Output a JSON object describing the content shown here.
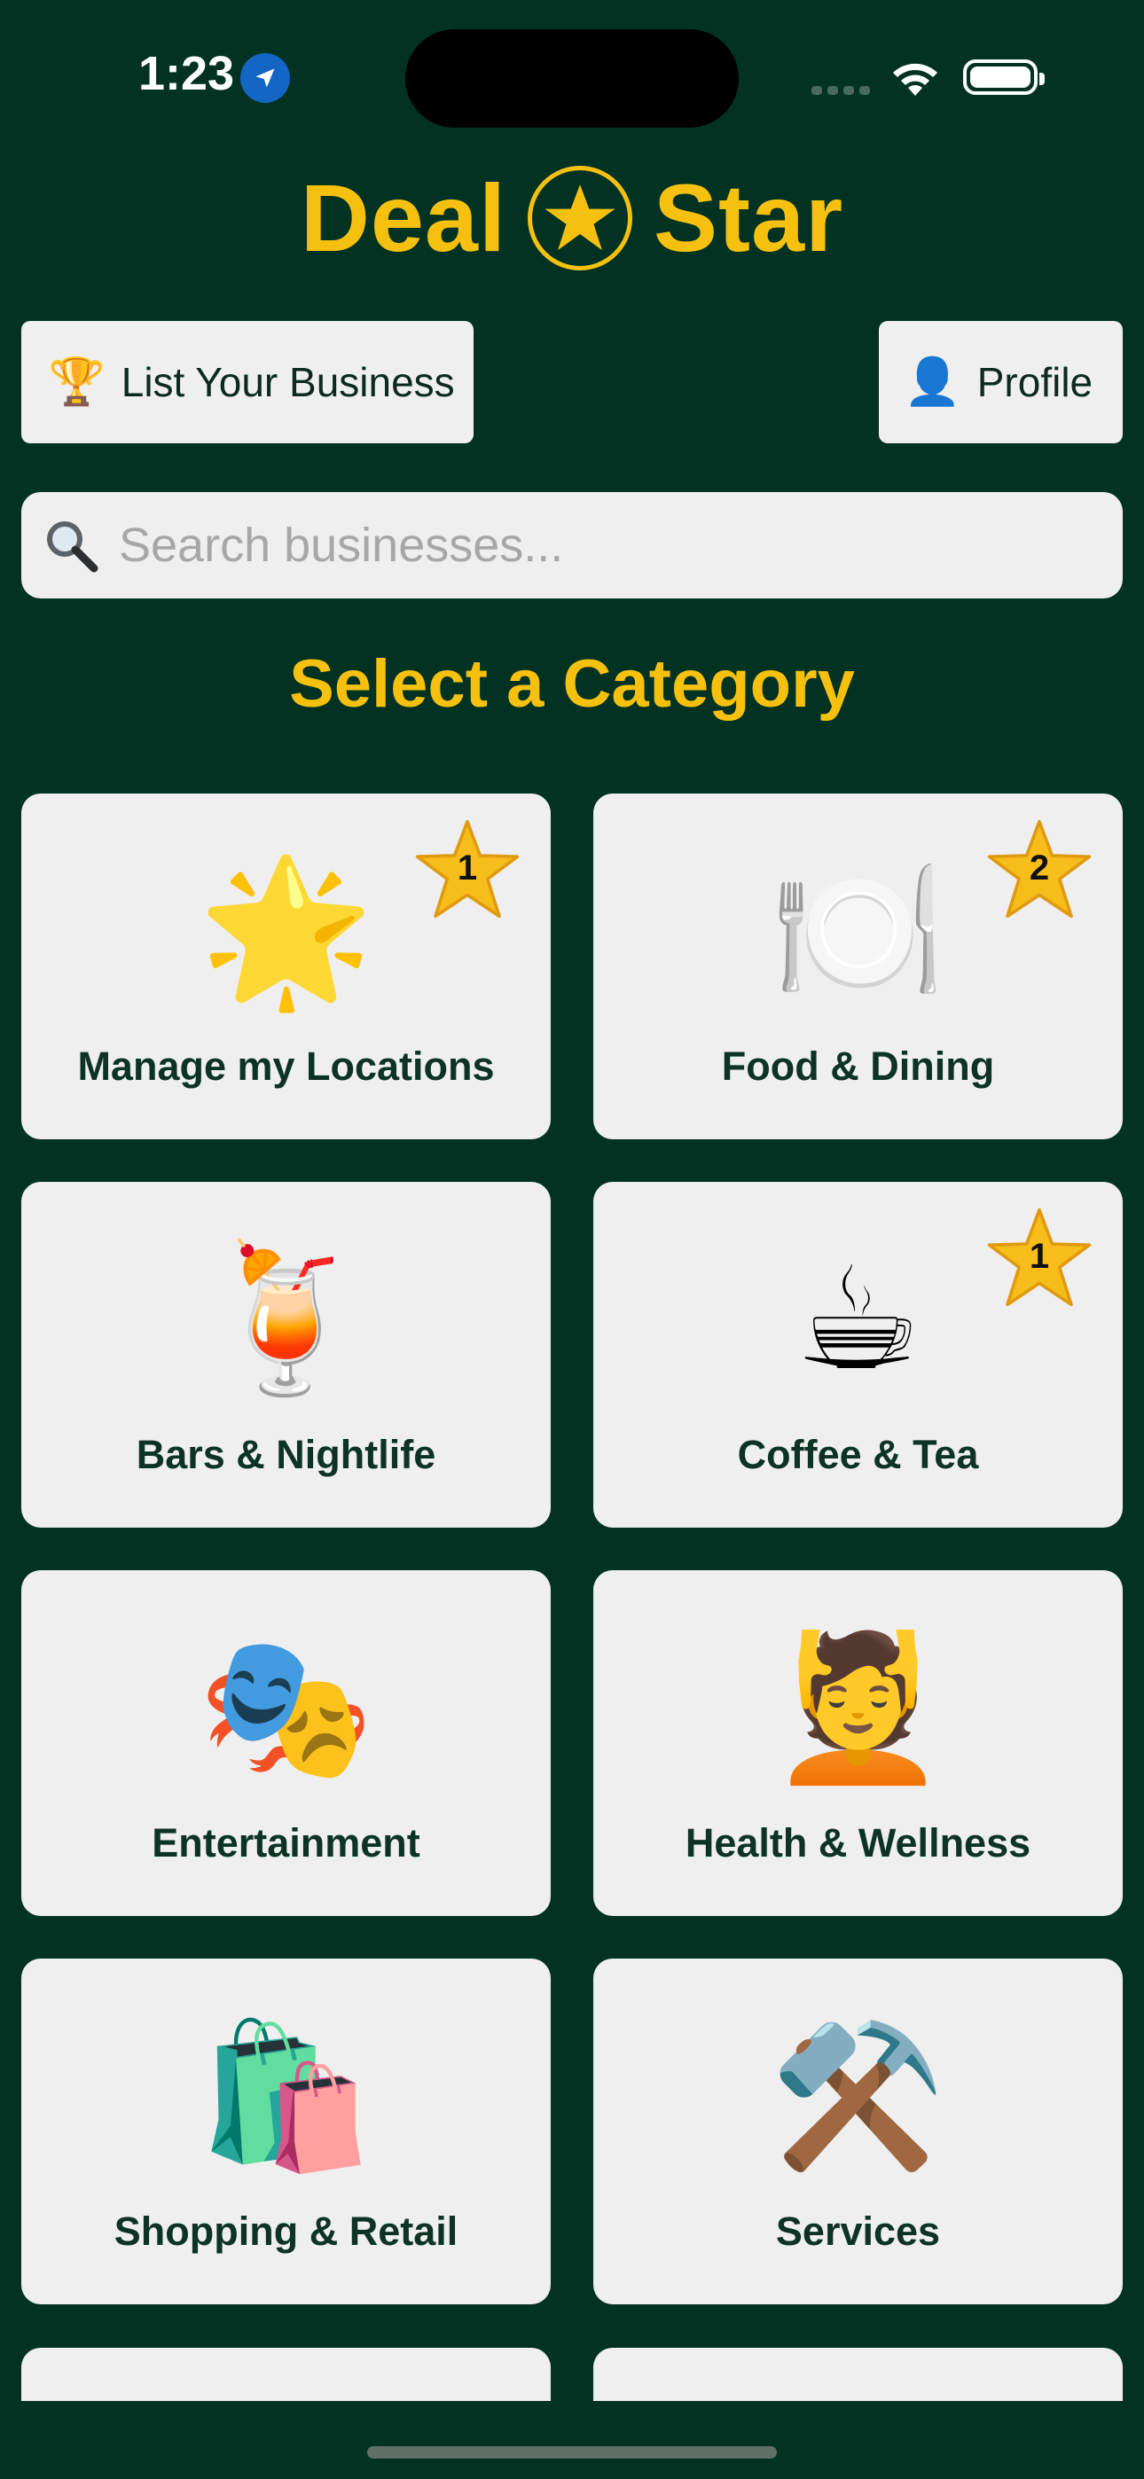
{
  "status_bar": {
    "time": "1:23"
  },
  "app": {
    "logo_left": "Deal",
    "logo_right": "Star"
  },
  "header": {
    "list_business": {
      "icon": "🏆",
      "label": "List Your Business"
    },
    "profile": {
      "icon": "👤",
      "label": "Profile"
    }
  },
  "search": {
    "placeholder": "Search businesses..."
  },
  "section_title": "Select a Category",
  "categories": [
    {
      "emoji": "🌟",
      "label": "Manage my Locations",
      "badge": "1"
    },
    {
      "emoji": "🍽️",
      "label": "Food & Dining",
      "badge": "2"
    },
    {
      "emoji": "🍹",
      "label": "Bars & Nightlife"
    },
    {
      "emoji": "☕",
      "label": "Coffee & Tea",
      "badge": "1"
    },
    {
      "emoji": "🎭",
      "label": "Entertainment"
    },
    {
      "emoji": "💆",
      "label": "Health & Wellness"
    },
    {
      "emoji": "🛍️",
      "label": "Shopping & Retail"
    },
    {
      "emoji": "⚒️",
      "label": "Services"
    }
  ],
  "colors": {
    "background": "#023222",
    "accent": "#f6c10e",
    "card": "#efefef",
    "label": "#0d3324"
  }
}
